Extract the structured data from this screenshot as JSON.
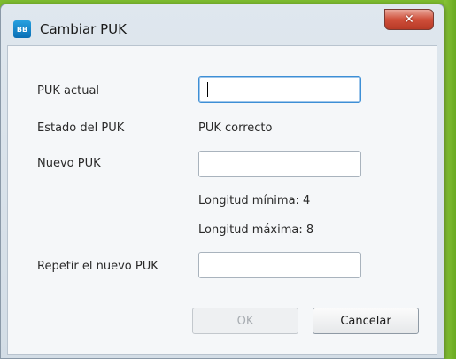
{
  "window": {
    "title": "Cambiar PUK",
    "icon": "sim-card-icon",
    "icon_text": "BB",
    "close_glyph": "✕"
  },
  "form": {
    "current_puk_label": "PUK actual",
    "current_puk_value": "",
    "status_label": "Estado del  PUK",
    "status_value": "PUK correcto",
    "new_puk_label": "Nuevo PUK",
    "new_puk_value": "",
    "min_length_text": "Longitud mínima: 4",
    "max_length_text": "Longitud máxima: 8",
    "repeat_puk_label": "Repetir el nuevo PUK",
    "repeat_puk_value": ""
  },
  "buttons": {
    "ok_label": "OK",
    "cancel_label": "Cancelar"
  },
  "colors": {
    "background": "#7dbb2f",
    "close_button": "#cf4f3a",
    "focus_border": "#3d8fd6"
  }
}
